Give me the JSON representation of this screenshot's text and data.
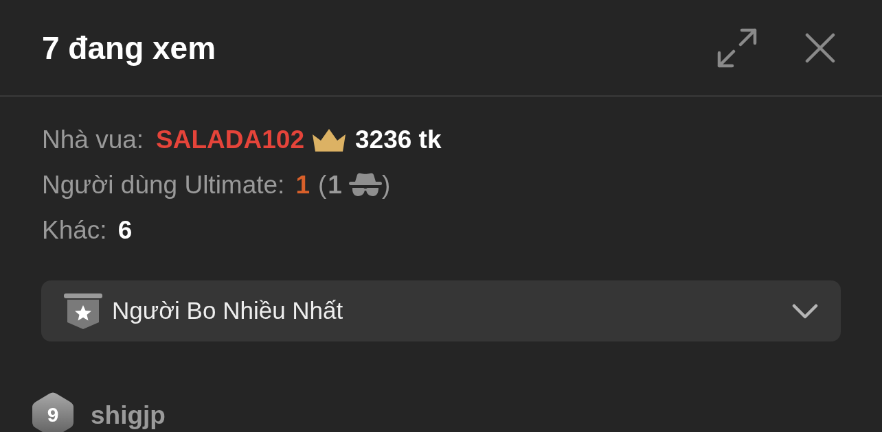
{
  "header": {
    "title": "7 đang xem"
  },
  "stats": {
    "king": {
      "label": "Nhà vua:",
      "name": "SALADA102",
      "tokens": "3236 tk"
    },
    "ultimate": {
      "label": "Người dùng Ultimate:",
      "count": "1",
      "open_paren": "(",
      "anonymous_count": "1",
      "close_paren": ")"
    },
    "other": {
      "label": "Khác:",
      "count": "6"
    }
  },
  "sort_dropdown": {
    "value": "Người Bo Nhiều Nhất",
    "expanded": false
  },
  "viewers": [
    {
      "level": "9",
      "name": "shigjp"
    }
  ]
}
